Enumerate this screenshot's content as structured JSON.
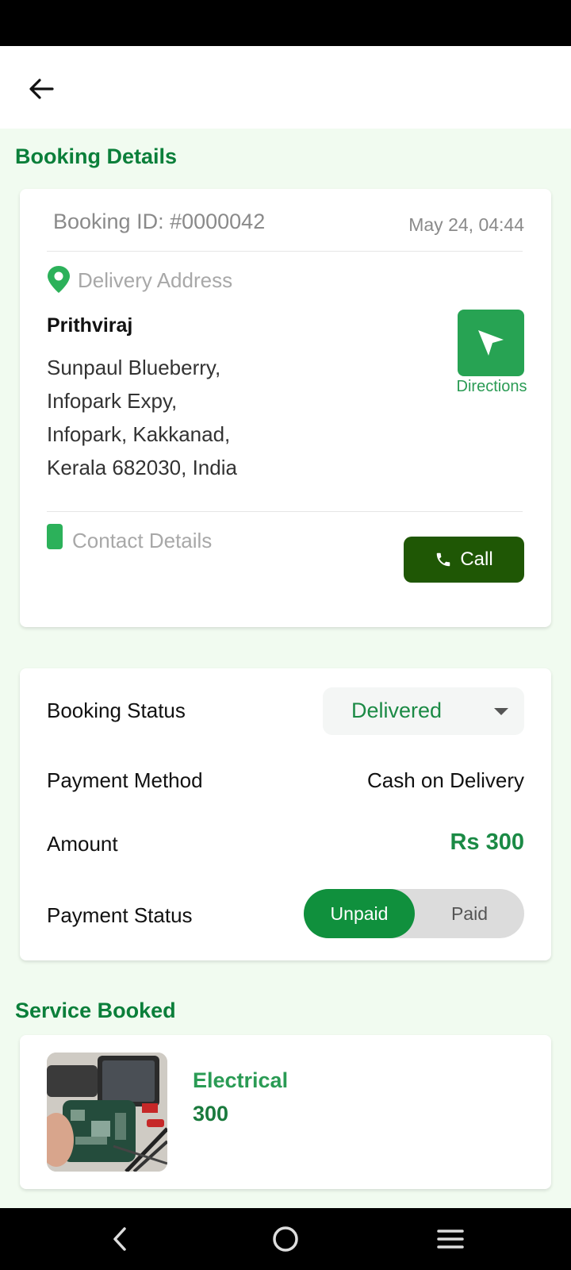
{
  "sections": {
    "booking_details": "Booking Details",
    "service_booked": "Service Booked"
  },
  "booking": {
    "id_label": "Booking ID: #0000042",
    "date": "May 24, 04:44",
    "delivery_address_label": "Delivery Address",
    "customer_name": "Prithviraj",
    "address_lines": [
      "Sunpaul Blueberry,",
      "Infopark Expy,",
      "Infopark, Kakkanad,",
      "Kerala 682030, India"
    ],
    "directions_label": "Directions",
    "contact_label": "Contact Details",
    "call_label": "Call"
  },
  "status": {
    "booking_status_label": "Booking Status",
    "booking_status_value": "Delivered",
    "payment_method_label": "Payment Method",
    "payment_method_value": "Cash on Delivery",
    "amount_label": "Amount",
    "amount_value": "Rs 300",
    "payment_status_label": "Payment Status",
    "payment_options": [
      "Unpaid",
      "Paid"
    ],
    "payment_selected": "Unpaid"
  },
  "service": {
    "name": "Electrical",
    "price": "300"
  },
  "icons": {
    "back": "arrow-left-icon",
    "pin": "location-pin-icon",
    "directions": "navigation-arrow-icon",
    "phone": "mobile-phone-icon",
    "call": "phone-handset-icon",
    "dropdown": "caret-down-icon"
  },
  "colors": {
    "primary": "#10903d",
    "accent_text": "#1b8a45",
    "call_button": "#1f5705",
    "background": "#f1fbf0"
  }
}
